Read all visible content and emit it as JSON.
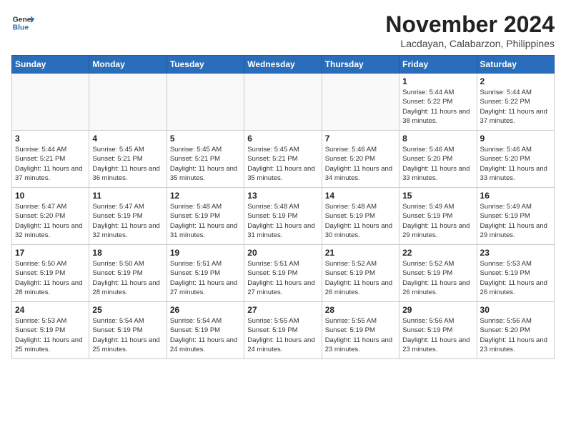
{
  "header": {
    "logo_line1": "General",
    "logo_line2": "Blue",
    "month_title": "November 2024",
    "location": "Lacdayan, Calabarzon, Philippines"
  },
  "weekdays": [
    "Sunday",
    "Monday",
    "Tuesday",
    "Wednesday",
    "Thursday",
    "Friday",
    "Saturday"
  ],
  "weeks": [
    [
      {
        "day": "",
        "info": ""
      },
      {
        "day": "",
        "info": ""
      },
      {
        "day": "",
        "info": ""
      },
      {
        "day": "",
        "info": ""
      },
      {
        "day": "",
        "info": ""
      },
      {
        "day": "1",
        "info": "Sunrise: 5:44 AM\nSunset: 5:22 PM\nDaylight: 11 hours\nand 38 minutes."
      },
      {
        "day": "2",
        "info": "Sunrise: 5:44 AM\nSunset: 5:22 PM\nDaylight: 11 hours\nand 37 minutes."
      }
    ],
    [
      {
        "day": "3",
        "info": "Sunrise: 5:44 AM\nSunset: 5:21 PM\nDaylight: 11 hours\nand 37 minutes."
      },
      {
        "day": "4",
        "info": "Sunrise: 5:45 AM\nSunset: 5:21 PM\nDaylight: 11 hours\nand 36 minutes."
      },
      {
        "day": "5",
        "info": "Sunrise: 5:45 AM\nSunset: 5:21 PM\nDaylight: 11 hours\nand 35 minutes."
      },
      {
        "day": "6",
        "info": "Sunrise: 5:45 AM\nSunset: 5:21 PM\nDaylight: 11 hours\nand 35 minutes."
      },
      {
        "day": "7",
        "info": "Sunrise: 5:46 AM\nSunset: 5:20 PM\nDaylight: 11 hours\nand 34 minutes."
      },
      {
        "day": "8",
        "info": "Sunrise: 5:46 AM\nSunset: 5:20 PM\nDaylight: 11 hours\nand 33 minutes."
      },
      {
        "day": "9",
        "info": "Sunrise: 5:46 AM\nSunset: 5:20 PM\nDaylight: 11 hours\nand 33 minutes."
      }
    ],
    [
      {
        "day": "10",
        "info": "Sunrise: 5:47 AM\nSunset: 5:20 PM\nDaylight: 11 hours\nand 32 minutes."
      },
      {
        "day": "11",
        "info": "Sunrise: 5:47 AM\nSunset: 5:19 PM\nDaylight: 11 hours\nand 32 minutes."
      },
      {
        "day": "12",
        "info": "Sunrise: 5:48 AM\nSunset: 5:19 PM\nDaylight: 11 hours\nand 31 minutes."
      },
      {
        "day": "13",
        "info": "Sunrise: 5:48 AM\nSunset: 5:19 PM\nDaylight: 11 hours\nand 31 minutes."
      },
      {
        "day": "14",
        "info": "Sunrise: 5:48 AM\nSunset: 5:19 PM\nDaylight: 11 hours\nand 30 minutes."
      },
      {
        "day": "15",
        "info": "Sunrise: 5:49 AM\nSunset: 5:19 PM\nDaylight: 11 hours\nand 29 minutes."
      },
      {
        "day": "16",
        "info": "Sunrise: 5:49 AM\nSunset: 5:19 PM\nDaylight: 11 hours\nand 29 minutes."
      }
    ],
    [
      {
        "day": "17",
        "info": "Sunrise: 5:50 AM\nSunset: 5:19 PM\nDaylight: 11 hours\nand 28 minutes."
      },
      {
        "day": "18",
        "info": "Sunrise: 5:50 AM\nSunset: 5:19 PM\nDaylight: 11 hours\nand 28 minutes."
      },
      {
        "day": "19",
        "info": "Sunrise: 5:51 AM\nSunset: 5:19 PM\nDaylight: 11 hours\nand 27 minutes."
      },
      {
        "day": "20",
        "info": "Sunrise: 5:51 AM\nSunset: 5:19 PM\nDaylight: 11 hours\nand 27 minutes."
      },
      {
        "day": "21",
        "info": "Sunrise: 5:52 AM\nSunset: 5:19 PM\nDaylight: 11 hours\nand 26 minutes."
      },
      {
        "day": "22",
        "info": "Sunrise: 5:52 AM\nSunset: 5:19 PM\nDaylight: 11 hours\nand 26 minutes."
      },
      {
        "day": "23",
        "info": "Sunrise: 5:53 AM\nSunset: 5:19 PM\nDaylight: 11 hours\nand 26 minutes."
      }
    ],
    [
      {
        "day": "24",
        "info": "Sunrise: 5:53 AM\nSunset: 5:19 PM\nDaylight: 11 hours\nand 25 minutes."
      },
      {
        "day": "25",
        "info": "Sunrise: 5:54 AM\nSunset: 5:19 PM\nDaylight: 11 hours\nand 25 minutes."
      },
      {
        "day": "26",
        "info": "Sunrise: 5:54 AM\nSunset: 5:19 PM\nDaylight: 11 hours\nand 24 minutes."
      },
      {
        "day": "27",
        "info": "Sunrise: 5:55 AM\nSunset: 5:19 PM\nDaylight: 11 hours\nand 24 minutes."
      },
      {
        "day": "28",
        "info": "Sunrise: 5:55 AM\nSunset: 5:19 PM\nDaylight: 11 hours\nand 23 minutes."
      },
      {
        "day": "29",
        "info": "Sunrise: 5:56 AM\nSunset: 5:19 PM\nDaylight: 11 hours\nand 23 minutes."
      },
      {
        "day": "30",
        "info": "Sunrise: 5:56 AM\nSunset: 5:20 PM\nDaylight: 11 hours\nand 23 minutes."
      }
    ]
  ]
}
